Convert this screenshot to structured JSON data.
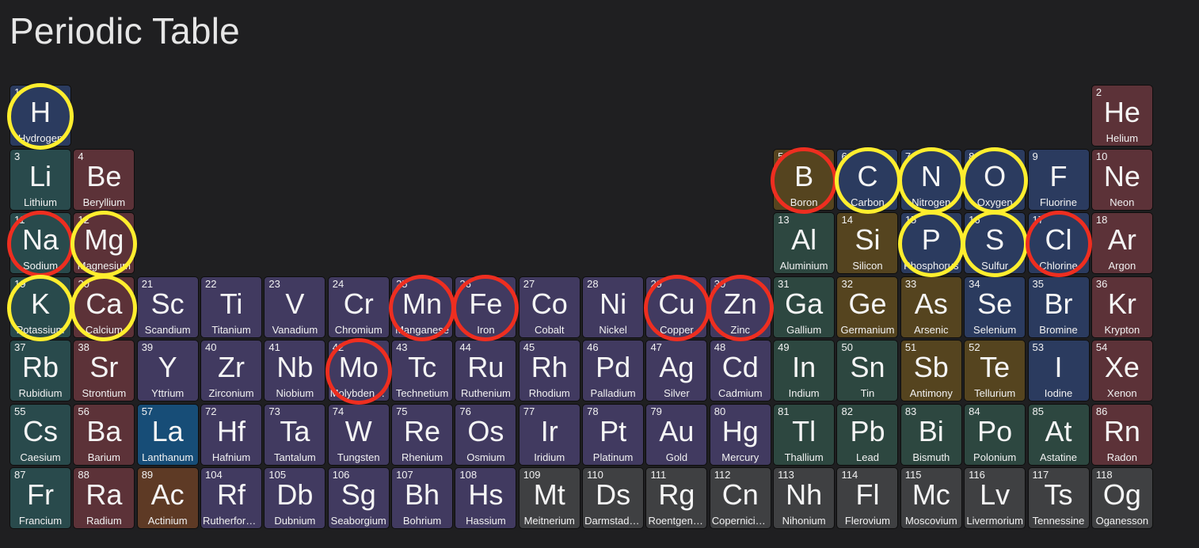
{
  "page": {
    "title": "Periodic Table"
  },
  "colors": {
    "alkali": "#294a4c",
    "alkaline": "#5c3238",
    "transition": "#413a60",
    "post_transition": "#2d4740",
    "metalloid": "#55441f",
    "nonmetal": "#2b3b5f",
    "noble": "#5c3238",
    "lanthanide": "#174d77",
    "actinide": "#5e3a25",
    "unknown": "#3f4042",
    "highlight_yellow": "#ffee2e",
    "highlight_red": "#ee2e20"
  },
  "elements": [
    {
      "n": 1,
      "sym": "H",
      "name": "Hydrogen",
      "cat": "nonmetal",
      "r": 1,
      "c": 1,
      "hl": "yellow"
    },
    {
      "n": 2,
      "sym": "He",
      "name": "Helium",
      "cat": "noble",
      "r": 1,
      "c": 18
    },
    {
      "n": 3,
      "sym": "Li",
      "name": "Lithium",
      "cat": "alkali",
      "r": 2,
      "c": 1
    },
    {
      "n": 4,
      "sym": "Be",
      "name": "Beryllium",
      "cat": "alkaline",
      "r": 2,
      "c": 2
    },
    {
      "n": 5,
      "sym": "B",
      "name": "Boron",
      "cat": "metalloid",
      "r": 2,
      "c": 13,
      "hl": "red"
    },
    {
      "n": 6,
      "sym": "C",
      "name": "Carbon",
      "cat": "nonmetal",
      "r": 2,
      "c": 14,
      "hl": "yellow"
    },
    {
      "n": 7,
      "sym": "N",
      "name": "Nitrogen",
      "cat": "nonmetal",
      "r": 2,
      "c": 15,
      "hl": "yellow"
    },
    {
      "n": 8,
      "sym": "O",
      "name": "Oxygen",
      "cat": "nonmetal",
      "r": 2,
      "c": 16,
      "hl": "yellow"
    },
    {
      "n": 9,
      "sym": "F",
      "name": "Fluorine",
      "cat": "nonmetal",
      "r": 2,
      "c": 17
    },
    {
      "n": 10,
      "sym": "Ne",
      "name": "Neon",
      "cat": "noble",
      "r": 2,
      "c": 18
    },
    {
      "n": 11,
      "sym": "Na",
      "name": "Sodium",
      "cat": "alkali",
      "r": 3,
      "c": 1,
      "hl": "red"
    },
    {
      "n": 12,
      "sym": "Mg",
      "name": "Magnesium",
      "cat": "alkaline",
      "r": 3,
      "c": 2,
      "hl": "yellow"
    },
    {
      "n": 13,
      "sym": "Al",
      "name": "Aluminium",
      "cat": "post_transition",
      "r": 3,
      "c": 13
    },
    {
      "n": 14,
      "sym": "Si",
      "name": "Silicon",
      "cat": "metalloid",
      "r": 3,
      "c": 14
    },
    {
      "n": 15,
      "sym": "P",
      "name": "Phosphorus",
      "cat": "nonmetal",
      "r": 3,
      "c": 15,
      "hl": "yellow"
    },
    {
      "n": 16,
      "sym": "S",
      "name": "Sulfur",
      "cat": "nonmetal",
      "r": 3,
      "c": 16,
      "hl": "yellow"
    },
    {
      "n": 17,
      "sym": "Cl",
      "name": "Chlorine",
      "cat": "nonmetal",
      "r": 3,
      "c": 17,
      "hl": "red"
    },
    {
      "n": 18,
      "sym": "Ar",
      "name": "Argon",
      "cat": "noble",
      "r": 3,
      "c": 18
    },
    {
      "n": 19,
      "sym": "K",
      "name": "Potassium",
      "cat": "alkali",
      "r": 4,
      "c": 1,
      "hl": "yellow"
    },
    {
      "n": 20,
      "sym": "Ca",
      "name": "Calcium",
      "cat": "alkaline",
      "r": 4,
      "c": 2,
      "hl": "yellow"
    },
    {
      "n": 21,
      "sym": "Sc",
      "name": "Scandium",
      "cat": "transition",
      "r": 4,
      "c": 3
    },
    {
      "n": 22,
      "sym": "Ti",
      "name": "Titanium",
      "cat": "transition",
      "r": 4,
      "c": 4
    },
    {
      "n": 23,
      "sym": "V",
      "name": "Vanadium",
      "cat": "transition",
      "r": 4,
      "c": 5
    },
    {
      "n": 24,
      "sym": "Cr",
      "name": "Chromium",
      "cat": "transition",
      "r": 4,
      "c": 6
    },
    {
      "n": 25,
      "sym": "Mn",
      "name": "Manganese",
      "cat": "transition",
      "r": 4,
      "c": 7,
      "hl": "red"
    },
    {
      "n": 26,
      "sym": "Fe",
      "name": "Iron",
      "cat": "transition",
      "r": 4,
      "c": 8,
      "hl": "red"
    },
    {
      "n": 27,
      "sym": "Co",
      "name": "Cobalt",
      "cat": "transition",
      "r": 4,
      "c": 9
    },
    {
      "n": 28,
      "sym": "Ni",
      "name": "Nickel",
      "cat": "transition",
      "r": 4,
      "c": 10
    },
    {
      "n": 29,
      "sym": "Cu",
      "name": "Copper",
      "cat": "transition",
      "r": 4,
      "c": 11,
      "hl": "red"
    },
    {
      "n": 30,
      "sym": "Zn",
      "name": "Zinc",
      "cat": "transition",
      "r": 4,
      "c": 12,
      "hl": "red"
    },
    {
      "n": 31,
      "sym": "Ga",
      "name": "Gallium",
      "cat": "post_transition",
      "r": 4,
      "c": 13
    },
    {
      "n": 32,
      "sym": "Ge",
      "name": "Germanium",
      "cat": "metalloid",
      "r": 4,
      "c": 14
    },
    {
      "n": 33,
      "sym": "As",
      "name": "Arsenic",
      "cat": "metalloid",
      "r": 4,
      "c": 15
    },
    {
      "n": 34,
      "sym": "Se",
      "name": "Selenium",
      "cat": "nonmetal",
      "r": 4,
      "c": 16
    },
    {
      "n": 35,
      "sym": "Br",
      "name": "Bromine",
      "cat": "nonmetal",
      "r": 4,
      "c": 17
    },
    {
      "n": 36,
      "sym": "Kr",
      "name": "Krypton",
      "cat": "noble",
      "r": 4,
      "c": 18
    },
    {
      "n": 37,
      "sym": "Rb",
      "name": "Rubidium",
      "cat": "alkali",
      "r": 5,
      "c": 1
    },
    {
      "n": 38,
      "sym": "Sr",
      "name": "Strontium",
      "cat": "alkaline",
      "r": 5,
      "c": 2
    },
    {
      "n": 39,
      "sym": "Y",
      "name": "Yttrium",
      "cat": "transition",
      "r": 5,
      "c": 3
    },
    {
      "n": 40,
      "sym": "Zr",
      "name": "Zirconium",
      "cat": "transition",
      "r": 5,
      "c": 4
    },
    {
      "n": 41,
      "sym": "Nb",
      "name": "Niobium",
      "cat": "transition",
      "r": 5,
      "c": 5
    },
    {
      "n": 42,
      "sym": "Mo",
      "name": "Molybdenum",
      "cat": "transition",
      "r": 5,
      "c": 6,
      "hl": "red"
    },
    {
      "n": 43,
      "sym": "Tc",
      "name": "Technetium",
      "cat": "transition",
      "r": 5,
      "c": 7
    },
    {
      "n": 44,
      "sym": "Ru",
      "name": "Ruthenium",
      "cat": "transition",
      "r": 5,
      "c": 8
    },
    {
      "n": 45,
      "sym": "Rh",
      "name": "Rhodium",
      "cat": "transition",
      "r": 5,
      "c": 9
    },
    {
      "n": 46,
      "sym": "Pd",
      "name": "Palladium",
      "cat": "transition",
      "r": 5,
      "c": 10
    },
    {
      "n": 47,
      "sym": "Ag",
      "name": "Silver",
      "cat": "transition",
      "r": 5,
      "c": 11
    },
    {
      "n": 48,
      "sym": "Cd",
      "name": "Cadmium",
      "cat": "transition",
      "r": 5,
      "c": 12
    },
    {
      "n": 49,
      "sym": "In",
      "name": "Indium",
      "cat": "post_transition",
      "r": 5,
      "c": 13
    },
    {
      "n": 50,
      "sym": "Sn",
      "name": "Tin",
      "cat": "post_transition",
      "r": 5,
      "c": 14
    },
    {
      "n": 51,
      "sym": "Sb",
      "name": "Antimony",
      "cat": "metalloid",
      "r": 5,
      "c": 15
    },
    {
      "n": 52,
      "sym": "Te",
      "name": "Tellurium",
      "cat": "metalloid",
      "r": 5,
      "c": 16
    },
    {
      "n": 53,
      "sym": "I",
      "name": "Iodine",
      "cat": "nonmetal",
      "r": 5,
      "c": 17
    },
    {
      "n": 54,
      "sym": "Xe",
      "name": "Xenon",
      "cat": "noble",
      "r": 5,
      "c": 18
    },
    {
      "n": 55,
      "sym": "Cs",
      "name": "Caesium",
      "cat": "alkali",
      "r": 6,
      "c": 1
    },
    {
      "n": 56,
      "sym": "Ba",
      "name": "Barium",
      "cat": "alkaline",
      "r": 6,
      "c": 2
    },
    {
      "n": 57,
      "sym": "La",
      "name": "Lanthanum",
      "cat": "lanthanide",
      "r": 6,
      "c": 3
    },
    {
      "n": 72,
      "sym": "Hf",
      "name": "Hafnium",
      "cat": "transition",
      "r": 6,
      "c": 4
    },
    {
      "n": 73,
      "sym": "Ta",
      "name": "Tantalum",
      "cat": "transition",
      "r": 6,
      "c": 5
    },
    {
      "n": 74,
      "sym": "W",
      "name": "Tungsten",
      "cat": "transition",
      "r": 6,
      "c": 6
    },
    {
      "n": 75,
      "sym": "Re",
      "name": "Rhenium",
      "cat": "transition",
      "r": 6,
      "c": 7
    },
    {
      "n": 76,
      "sym": "Os",
      "name": "Osmium",
      "cat": "transition",
      "r": 6,
      "c": 8
    },
    {
      "n": 77,
      "sym": "Ir",
      "name": "Iridium",
      "cat": "transition",
      "r": 6,
      "c": 9
    },
    {
      "n": 78,
      "sym": "Pt",
      "name": "Platinum",
      "cat": "transition",
      "r": 6,
      "c": 10
    },
    {
      "n": 79,
      "sym": "Au",
      "name": "Gold",
      "cat": "transition",
      "r": 6,
      "c": 11
    },
    {
      "n": 80,
      "sym": "Hg",
      "name": "Mercury",
      "cat": "transition",
      "r": 6,
      "c": 12
    },
    {
      "n": 81,
      "sym": "Tl",
      "name": "Thallium",
      "cat": "post_transition",
      "r": 6,
      "c": 13
    },
    {
      "n": 82,
      "sym": "Pb",
      "name": "Lead",
      "cat": "post_transition",
      "r": 6,
      "c": 14
    },
    {
      "n": 83,
      "sym": "Bi",
      "name": "Bismuth",
      "cat": "post_transition",
      "r": 6,
      "c": 15
    },
    {
      "n": 84,
      "sym": "Po",
      "name": "Polonium",
      "cat": "post_transition",
      "r": 6,
      "c": 16
    },
    {
      "n": 85,
      "sym": "At",
      "name": "Astatine",
      "cat": "post_transition",
      "r": 6,
      "c": 17
    },
    {
      "n": 86,
      "sym": "Rn",
      "name": "Radon",
      "cat": "noble",
      "r": 6,
      "c": 18
    },
    {
      "n": 87,
      "sym": "Fr",
      "name": "Francium",
      "cat": "alkali",
      "r": 7,
      "c": 1
    },
    {
      "n": 88,
      "sym": "Ra",
      "name": "Radium",
      "cat": "alkaline",
      "r": 7,
      "c": 2
    },
    {
      "n": 89,
      "sym": "Ac",
      "name": "Actinium",
      "cat": "actinide",
      "r": 7,
      "c": 3
    },
    {
      "n": 104,
      "sym": "Rf",
      "name": "Rutherfordium",
      "cat": "transition",
      "r": 7,
      "c": 4
    },
    {
      "n": 105,
      "sym": "Db",
      "name": "Dubnium",
      "cat": "transition",
      "r": 7,
      "c": 5
    },
    {
      "n": 106,
      "sym": "Sg",
      "name": "Seaborgium",
      "cat": "transition",
      "r": 7,
      "c": 6
    },
    {
      "n": 107,
      "sym": "Bh",
      "name": "Bohrium",
      "cat": "transition",
      "r": 7,
      "c": 7
    },
    {
      "n": 108,
      "sym": "Hs",
      "name": "Hassium",
      "cat": "transition",
      "r": 7,
      "c": 8
    },
    {
      "n": 109,
      "sym": "Mt",
      "name": "Meitnerium",
      "cat": "unknown",
      "r": 7,
      "c": 9
    },
    {
      "n": 110,
      "sym": "Ds",
      "name": "Darmstadtium",
      "cat": "unknown",
      "r": 7,
      "c": 10
    },
    {
      "n": 111,
      "sym": "Rg",
      "name": "Roentgenium",
      "cat": "unknown",
      "r": 7,
      "c": 11
    },
    {
      "n": 112,
      "sym": "Cn",
      "name": "Copernicium",
      "cat": "unknown",
      "r": 7,
      "c": 12
    },
    {
      "n": 113,
      "sym": "Nh",
      "name": "Nihonium",
      "cat": "unknown",
      "r": 7,
      "c": 13
    },
    {
      "n": 114,
      "sym": "Fl",
      "name": "Flerovium",
      "cat": "unknown",
      "r": 7,
      "c": 14
    },
    {
      "n": 115,
      "sym": "Mc",
      "name": "Moscovium",
      "cat": "unknown",
      "r": 7,
      "c": 15
    },
    {
      "n": 116,
      "sym": "Lv",
      "name": "Livermorium",
      "cat": "unknown",
      "r": 7,
      "c": 16
    },
    {
      "n": 117,
      "sym": "Ts",
      "name": "Tennessine",
      "cat": "unknown",
      "r": 7,
      "c": 17
    },
    {
      "n": 118,
      "sym": "Og",
      "name": "Oganesson",
      "cat": "unknown",
      "r": 7,
      "c": 18
    }
  ]
}
